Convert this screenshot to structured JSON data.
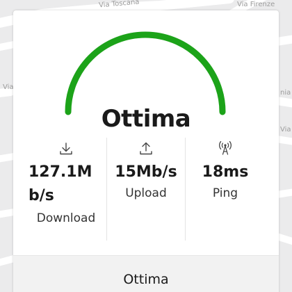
{
  "map": {
    "street_labels": [
      "Via Toscana",
      "Via Firenze",
      "Via",
      "nia",
      "Via M"
    ]
  },
  "speed_result": {
    "gauge_color": "#1ca319",
    "gauge_level": 1.0,
    "quality_label": "Ottima",
    "download": {
      "value": "127.1Mb/s",
      "label": "Download",
      "icon": "download-icon"
    },
    "upload": {
      "value": "15Mb/s",
      "label": "Upload",
      "icon": "upload-icon"
    },
    "ping": {
      "value": "18ms",
      "label": "Ping",
      "icon": "antenna-signal-icon"
    },
    "footer_label": "Ottima"
  }
}
